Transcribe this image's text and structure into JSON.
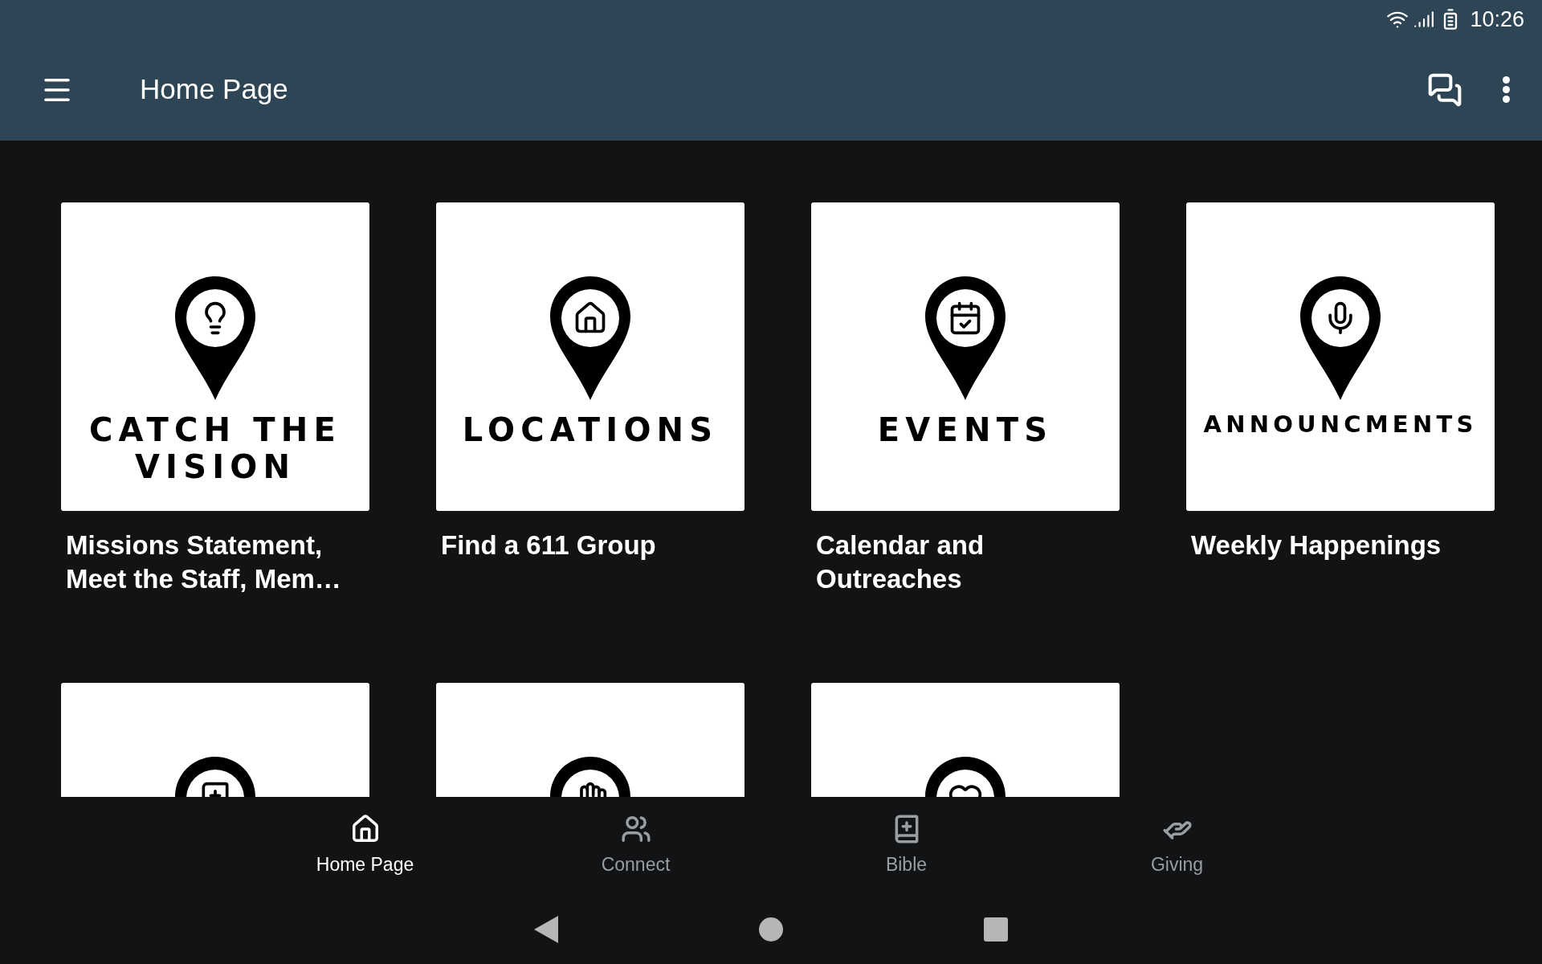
{
  "status_bar": {
    "time": "10:26"
  },
  "app_bar": {
    "title": "Home Page"
  },
  "tiles": [
    {
      "kind": "bulb",
      "image_text": "CATCH THE VISION",
      "caption": "Missions Statement, Meet the Staff, Mem…"
    },
    {
      "kind": "house",
      "image_text": "LOCATIONS",
      "caption": "Find a 611 Group"
    },
    {
      "kind": "calendar",
      "image_text": "EVENTS",
      "caption": "Calendar and Outreaches"
    },
    {
      "kind": "mic",
      "image_text": "ANNOUNCMENTS",
      "caption": "Weekly Happenings"
    },
    {
      "kind": "book"
    },
    {
      "kind": "hand"
    },
    {
      "kind": "heart"
    }
  ],
  "bottom_nav": [
    {
      "kind": "home",
      "label": "Home Page",
      "selected": true
    },
    {
      "kind": "people",
      "label": "Connect",
      "selected": false
    },
    {
      "kind": "bible",
      "label": "Bible",
      "selected": false
    },
    {
      "kind": "giving",
      "label": "Giving",
      "selected": false
    }
  ]
}
